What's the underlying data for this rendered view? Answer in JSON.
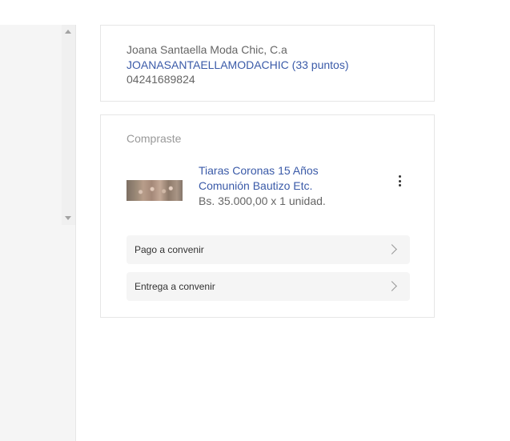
{
  "seller": {
    "name": "Joana Santaella Moda Chic, C.a",
    "nickname_points": "JOANASANTAELLAMODACHIC (33 puntos)",
    "phone": "04241689824"
  },
  "purchase": {
    "section_title": "Compraste",
    "product": {
      "title_line1": "Tiaras Coronas 15 Años",
      "title_line2": "Comunión Bautizo Etc.",
      "price_qty": "Bs. 35.000,00 x 1 unidad."
    },
    "payment_label": "Pago a convenir",
    "delivery_label": "Entrega a convenir"
  },
  "icons": {
    "more": "kebab-menu-icon",
    "chevron": "chevron-right-icon",
    "scroll_up": "scroll-up-arrow",
    "scroll_down": "scroll-down-arrow"
  },
  "colors": {
    "link": "#3a5aa8",
    "text_secondary": "#666666",
    "muted": "#999999",
    "row_bg": "#f5f5f5"
  }
}
